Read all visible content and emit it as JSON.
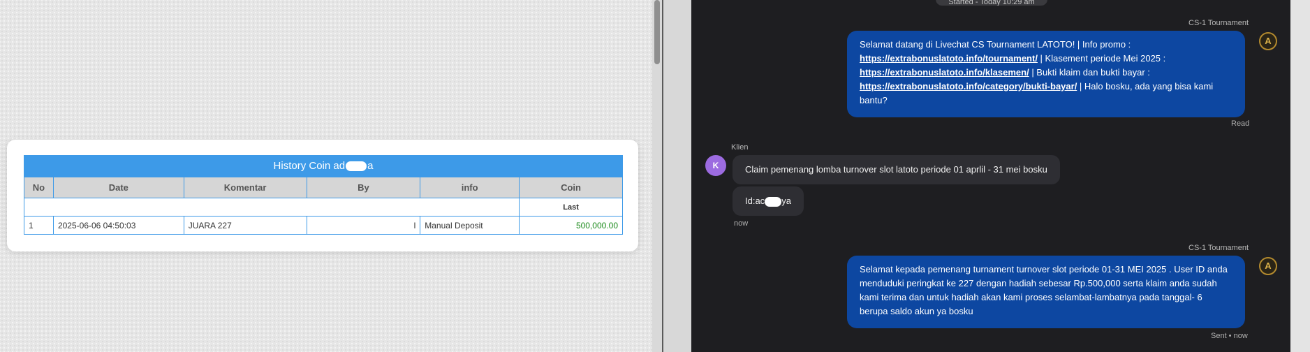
{
  "coin_history": {
    "title_prefix": "History Coin ad",
    "title_suffix": "a",
    "columns": [
      "No",
      "Date",
      "Komentar",
      "By",
      "info",
      "Coin"
    ],
    "sub_header": "Last",
    "rows": [
      {
        "no": "1",
        "date": "2025-06-06 04:50:03",
        "komentar": "JUARA 227",
        "by": "l",
        "info": "Manual Deposit",
        "coin": "500,000.00"
      }
    ]
  },
  "chat": {
    "started": "Started - Today 10:29 am",
    "agent_name": "CS-1 Tournament",
    "client_name": "Klien",
    "client_initial": "K",
    "agent_avatar": "A",
    "messages": {
      "agent_1": {
        "t1": "Selamat datang di Livechat CS Tournament LATOTO! | Info promo : ",
        "l1": "https://extrabonuslatoto.info/tournament/",
        "t2": " | Klasement periode Mei 2025 : ",
        "l2": "https://extrabonuslatoto.info/klasemen/",
        "t3": " | Bukti klaim dan bukti bayar : ",
        "l3": "https://extrabonuslatoto.info/category/bukti-bayar/",
        "t4": " | Halo bosku, ada yang bisa kami bantu?",
        "status": "Read"
      },
      "client_1": "Claim pemenang lomba turnover slot latoto periode 01 aprlil - 31 mei bosku",
      "client_2_prefix": "Id:ac",
      "client_2_suffix": "ya",
      "client_time": "now",
      "agent_2": {
        "text": "Selamat kepada pemenang turnament turnover slot periode 01-31 MEI 2025 . User ID anda menduduki peringkat ke 227 dengan hadiah sebesar Rp.500,000 serta klaim anda sudah kami terima dan untuk hadiah akan kami proses selambat-lambatnya pada tanggal- 6 berupa saldo akun ya bosku",
        "status": "Sent • now"
      }
    }
  },
  "colors": {
    "table_header_blue": "#3d9ae8",
    "agent_bubble": "#0d47a1",
    "client_bubble": "#2e2e33",
    "chat_bg": "#1e1e21",
    "coin_green": "#1b8a1b"
  }
}
